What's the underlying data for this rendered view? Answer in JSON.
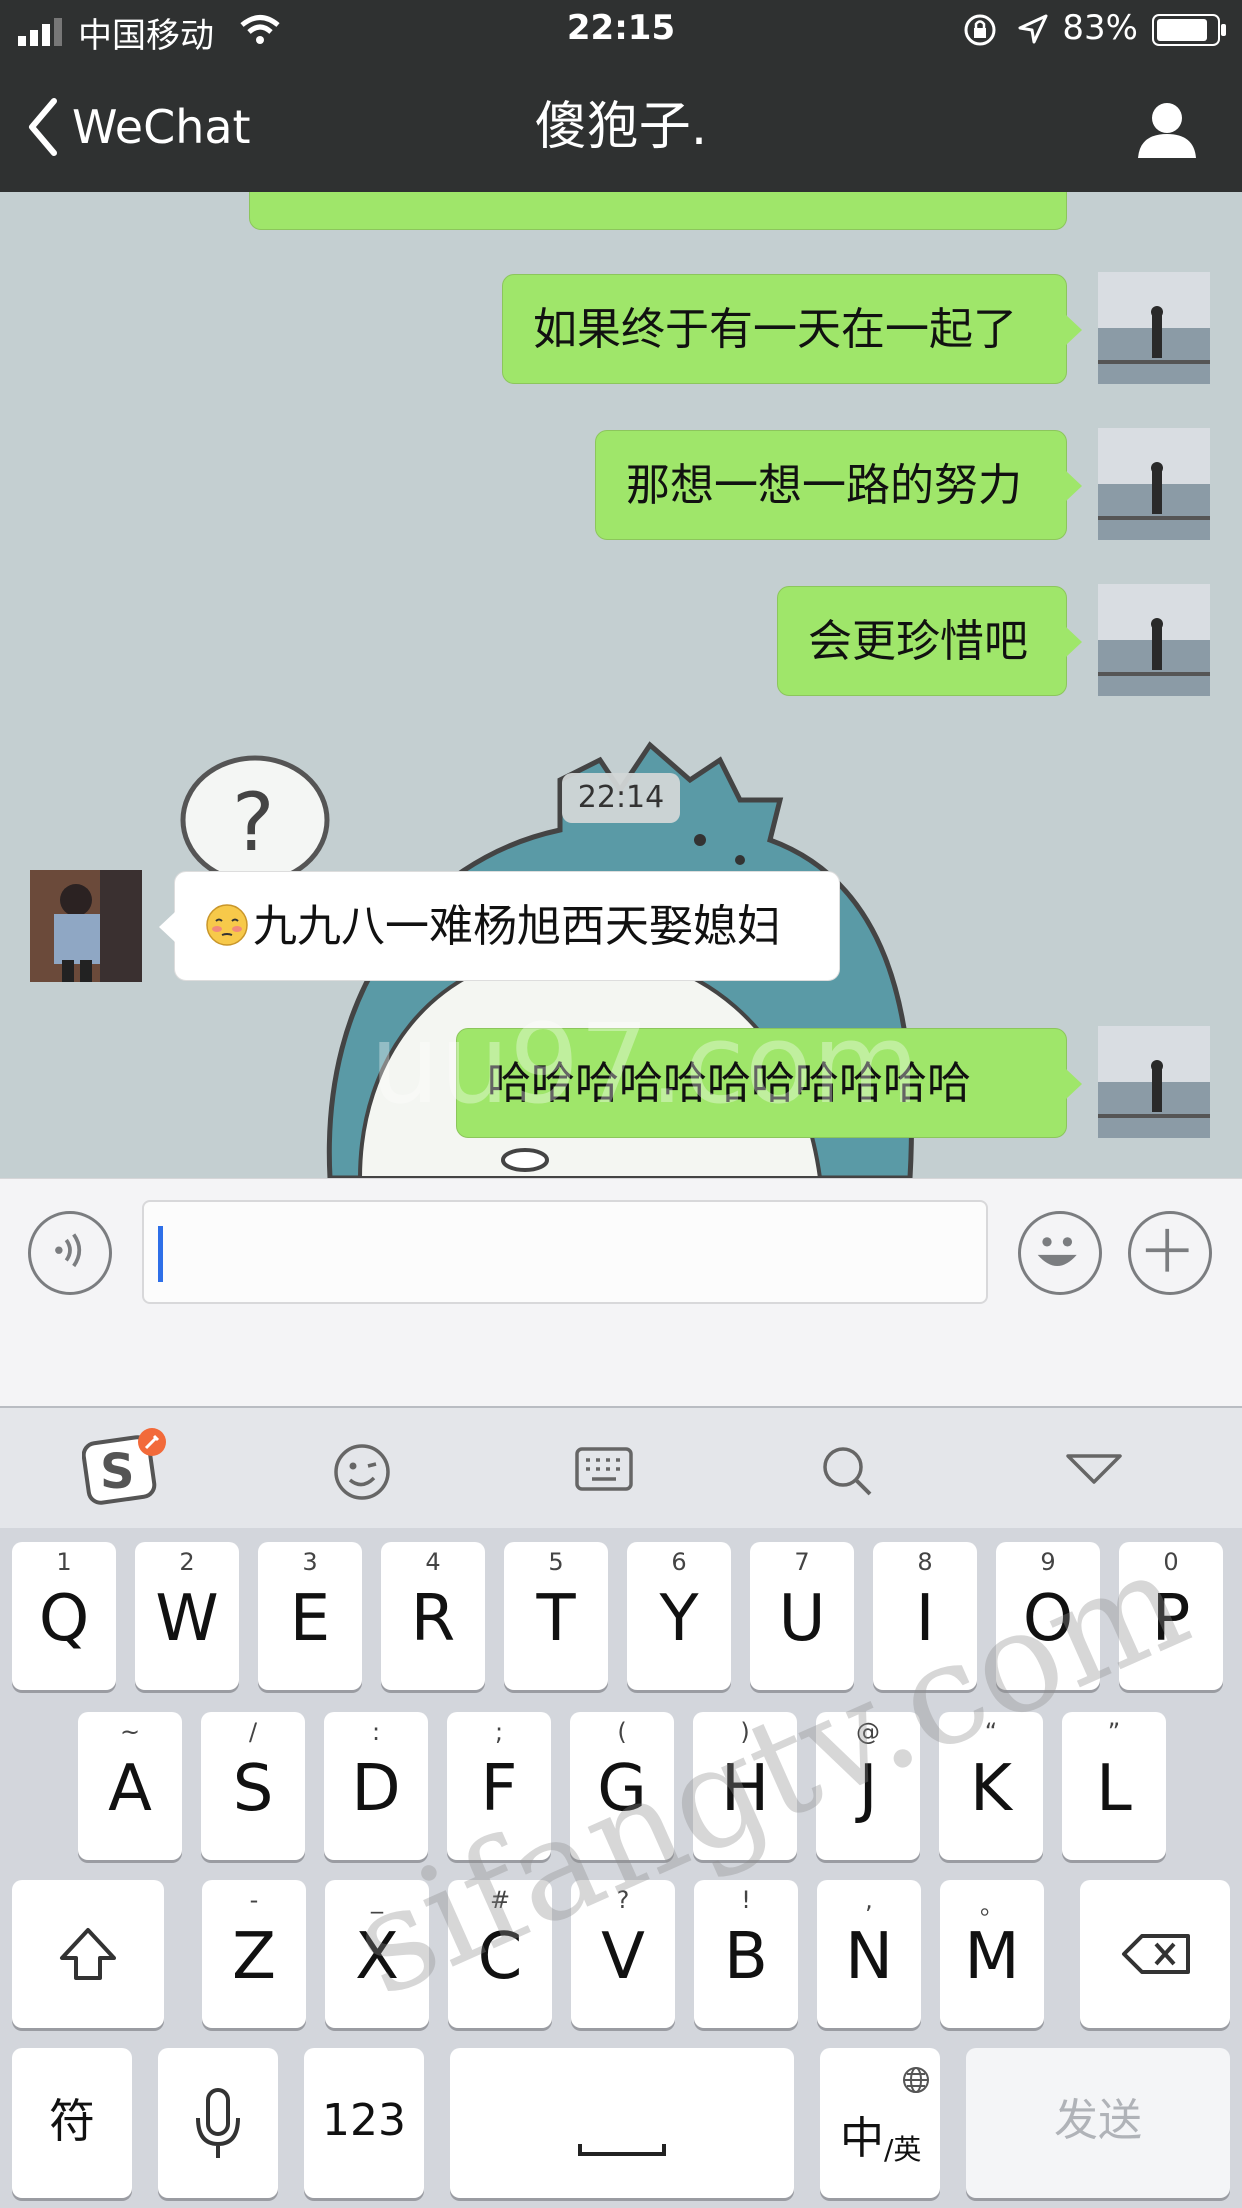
{
  "status_bar": {
    "carrier": "中国移动",
    "time": "22:15",
    "battery": "83%"
  },
  "nav": {
    "back_label": "WeChat",
    "title": "傻狍子."
  },
  "messages": [
    {
      "direction": "out",
      "text": "如果终于有一天在一起了"
    },
    {
      "direction": "out",
      "text": "那想一想一路的努力"
    },
    {
      "direction": "out",
      "text": "会更珍惜吧"
    },
    {
      "direction": "in",
      "text": "九九八一难杨旭西天娶媳妇",
      "emoji": "flushed-face-icon"
    },
    {
      "direction": "out",
      "text": "哈哈哈哈哈哈哈哈哈哈哈"
    }
  ],
  "timestamp": "22:14",
  "keyboard": {
    "row1": [
      {
        "sub": "1",
        "main": "Q"
      },
      {
        "sub": "2",
        "main": "W"
      },
      {
        "sub": "3",
        "main": "E"
      },
      {
        "sub": "4",
        "main": "R"
      },
      {
        "sub": "5",
        "main": "T"
      },
      {
        "sub": "6",
        "main": "Y"
      },
      {
        "sub": "7",
        "main": "U"
      },
      {
        "sub": "8",
        "main": "I"
      },
      {
        "sub": "9",
        "main": "O"
      },
      {
        "sub": "0",
        "main": "P"
      }
    ],
    "row2": [
      {
        "sub": "~",
        "main": "A"
      },
      {
        "sub": "/",
        "main": "S"
      },
      {
        "sub": ":",
        "main": "D"
      },
      {
        "sub": ";",
        "main": "F"
      },
      {
        "sub": "(",
        "main": "G"
      },
      {
        "sub": ")",
        "main": "H"
      },
      {
        "sub": "@",
        "main": "J"
      },
      {
        "sub": "“",
        "main": "K"
      },
      {
        "sub": "”",
        "main": "L"
      }
    ],
    "row3": [
      {
        "sub": "-",
        "main": "Z"
      },
      {
        "sub": "_",
        "main": "X"
      },
      {
        "sub": "#",
        "main": "C"
      },
      {
        "sub": "?",
        "main": "V"
      },
      {
        "sub": "!",
        "main": "B"
      },
      {
        "sub": ",",
        "main": "N"
      },
      {
        "sub": "。",
        "main": "M"
      }
    ],
    "symbols_label": "符",
    "numbers_label": "123",
    "lang_main": "中",
    "lang_sub": "/英",
    "send_label": "发送"
  },
  "watermarks": {
    "keyboard": "sifangtv.com",
    "chat": "uu97.com"
  },
  "colors": {
    "outgoing_bubble": "#9fe66a",
    "incoming_bubble": "#ffffff",
    "nav_bar": "#2f3131",
    "caret": "#2e6fe8"
  }
}
